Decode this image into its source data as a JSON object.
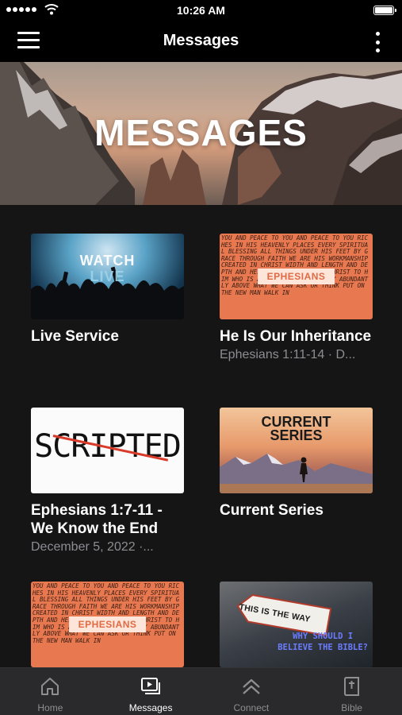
{
  "status_bar": {
    "time": "10:26 AM"
  },
  "nav": {
    "title": "Messages"
  },
  "hero": {
    "title": "MESSAGES"
  },
  "cards": [
    {
      "title": "Live Service",
      "subtitle": "",
      "thumb": {
        "line1": "WATCH",
        "line2": "LIVE"
      }
    },
    {
      "title": "He Is Our Inheritance",
      "subtitle": "Ephesians 1:11-14 · D...",
      "thumb": {
        "badge": "EPHESIANS",
        "pattern": "YOU AND PEACE TO YOU AND PEACE TO YOU RICHES IN HIS HEAVENLY PLACES EVERY SPIRITUAL BLESSING ALL THINGS UNDER HIS FEET BY GRACE THROUGH FAITH WE ARE HIS WORKMANSHIP CREATED IN CHRIST WIDTH AND LENGTH AND DEPTH AND HEIGHT OF THE LOVE OF CHRIST TO HIM WHO IS ABLE TO DO EXCEEDINGLY ABUNDANTLY ABOVE WHAT WE CAN ASK OR THINK PUT ON THE NEW MAN WALK IN"
      }
    },
    {
      "title": "Ephesians 1:7-11 - We Know the End",
      "subtitle": "December 5, 2022 ·...",
      "thumb": {
        "text": "SCRIPTED"
      }
    },
    {
      "title": "Current Series",
      "subtitle": "",
      "thumb": {
        "line1": "CURRENT",
        "line2": "SERIES"
      }
    },
    {
      "title": "",
      "subtitle": "",
      "thumb": {
        "badge": "EPHESIANS",
        "pattern": "YOU AND PEACE TO YOU AND PEACE TO YOU RICHES IN HIS HEAVENLY PLACES EVERY SPIRITUAL BLESSING ALL THINGS UNDER HIS FEET BY GRACE THROUGH FAITH WE ARE HIS WORKMANSHIP CREATED IN CHRIST WIDTH AND LENGTH AND DEPTH AND HEIGHT OF THE LOVE OF CHRIST TO HIM WHO IS ABLE TO DO EXCEEDINGLY ABUNDANTLY ABOVE WHAT WE CAN ASK OR THINK PUT ON THE NEW MAN WALK IN"
      }
    },
    {
      "title": "",
      "subtitle": "",
      "thumb": {
        "sign": "THIS IS THE WAY",
        "line1": "WHY SHOULD I",
        "line2": "BELIEVE THE BIBLE?"
      }
    }
  ],
  "tabs": [
    {
      "label": "Home",
      "icon": "home-icon",
      "active": false
    },
    {
      "label": "Messages",
      "icon": "messages-icon",
      "active": true
    },
    {
      "label": "Connect",
      "icon": "connect-icon",
      "active": false
    },
    {
      "label": "Bible",
      "icon": "bible-icon",
      "active": false
    }
  ]
}
